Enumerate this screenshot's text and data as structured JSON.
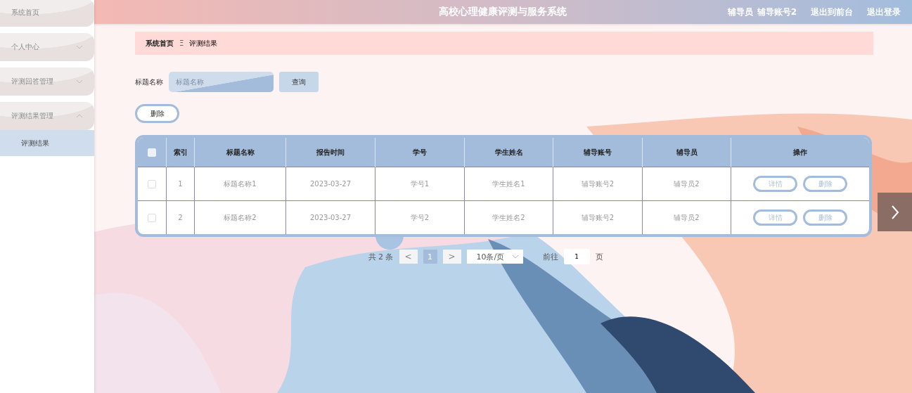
{
  "sidebar": {
    "items": [
      {
        "label": "系统首页"
      },
      {
        "label": "个人中心",
        "expanded": false
      },
      {
        "label": "评测回答管理",
        "expanded": false
      },
      {
        "label": "评测结果管理",
        "expanded": true,
        "children": [
          {
            "label": "评测结果",
            "selected": true
          }
        ]
      }
    ]
  },
  "header": {
    "title": "高校心理健康评测与服务系统",
    "role": "辅导员",
    "account": "辅导账号2",
    "links": [
      "退出到前台",
      "退出登录"
    ]
  },
  "breadcrumb": {
    "items": [
      "系统首页",
      "评测结果"
    ],
    "separator": "Ξ"
  },
  "search": {
    "label": "标题名称",
    "placeholder": "标题名称",
    "button": "查询"
  },
  "delete_button": "删除",
  "table": {
    "header_checked": false,
    "columns": [
      "索引",
      "标题名称",
      "报告时间",
      "学号",
      "学生姓名",
      "辅导账号",
      "辅导员",
      "操作"
    ],
    "rows": [
      {
        "checked": false,
        "cells": [
          "1",
          "标题名称1",
          "2023-03-27",
          "学号1",
          "学生姓名1",
          "辅导账号2",
          "辅导员2"
        ],
        "actions": [
          "详情",
          "删除"
        ]
      },
      {
        "checked": false,
        "cells": [
          "2",
          "标题名称2",
          "2023-03-27",
          "学号2",
          "学生姓名2",
          "辅导账号2",
          "辅导员2"
        ],
        "actions": [
          "详情",
          "删除"
        ]
      }
    ]
  },
  "pagination": {
    "total": "共 2 条",
    "prev": "<",
    "pages": [
      {
        "label": "1",
        "selected": true
      }
    ],
    "next": ">",
    "page_size": "10条/页",
    "goto_label": "前往",
    "goto_value": "1",
    "goto_unit": "页"
  }
}
